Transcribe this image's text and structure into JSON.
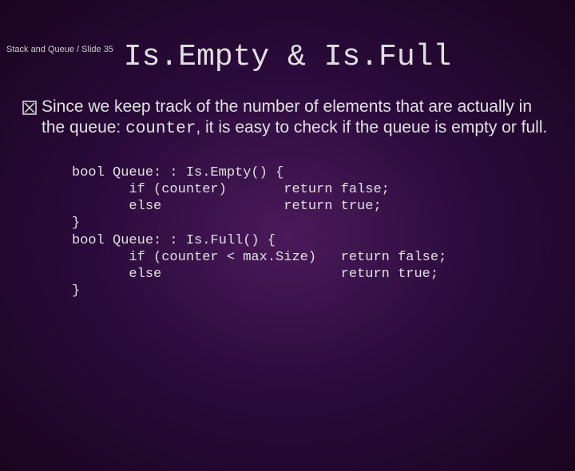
{
  "breadcrumb": "Stack and Queue / Slide 35",
  "title": "Is.Empty & Is.Full",
  "bullet": {
    "part1": "Since we keep track of the number of elements that are actually in the queue: ",
    "code": "counter",
    "part2": ", it is easy to check if the queue is empty or full."
  },
  "code": "bool Queue: : Is.Empty() {\n       if (counter)       return false;\n       else               return true;\n}\nbool Queue: : Is.Full() {\n       if (counter < max.Size)   return false;\n       else                      return true;\n}"
}
